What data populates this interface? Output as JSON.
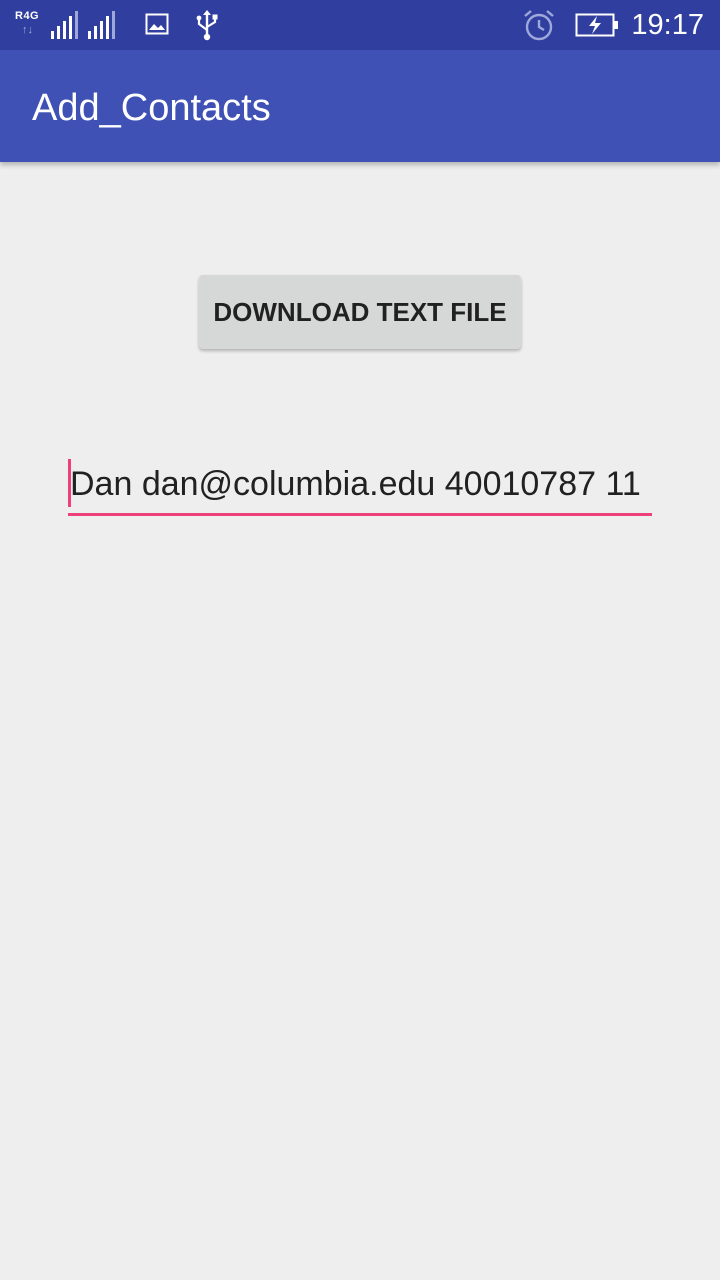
{
  "status_bar": {
    "network_type": "R4G",
    "network_arrows": "↑↓",
    "time": "19:17",
    "icons": [
      "signal-icon",
      "gallery-icon",
      "usb-icon",
      "alarm-icon",
      "battery-charging-icon"
    ]
  },
  "app_bar": {
    "title": "Add_Contacts"
  },
  "main": {
    "download_button_label": "DOWNLOAD TEXT FILE",
    "contact_input_value": "Dan dan@columbia.edu 40010787 11"
  },
  "colors": {
    "status_bar": "#303f9f",
    "primary": "#3f51b5",
    "accent": "#ec407a",
    "background": "#eeeeee",
    "button": "#d6d7d7"
  }
}
